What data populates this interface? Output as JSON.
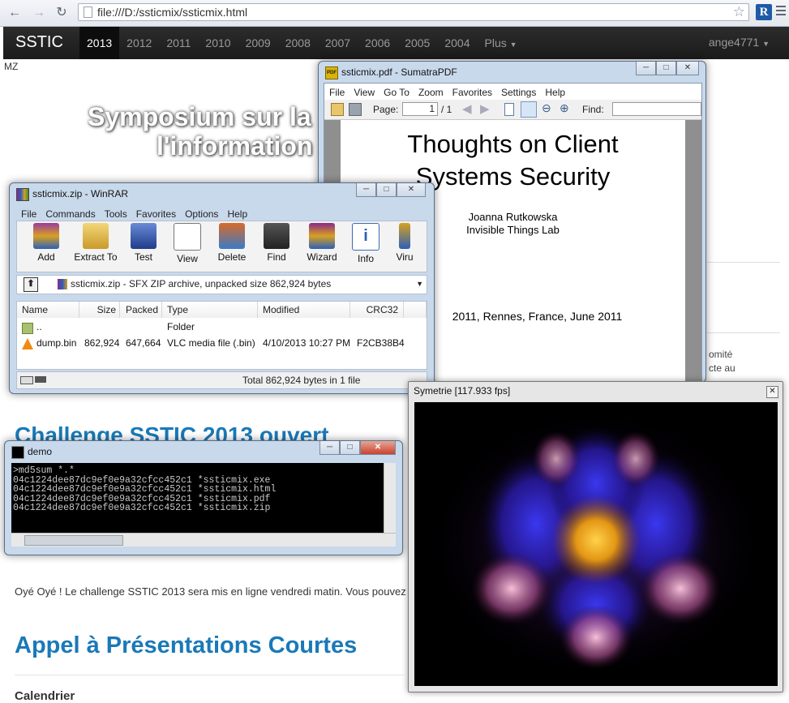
{
  "browser": {
    "url": "file:///D:/ssticmix/ssticmix.html",
    "back_icon": "arrow-left-icon",
    "forward_icon": "arrow-right-icon",
    "reload_icon": "reload-icon",
    "ext_label": "R"
  },
  "site": {
    "brand": "SSTIC",
    "years": [
      "2013",
      "2012",
      "2011",
      "2010",
      "2009",
      "2008",
      "2007",
      "2006",
      "2005",
      "2004"
    ],
    "more": "Plus",
    "user": "ange4771",
    "mz": "MZ",
    "title_l1": "Symposium sur la",
    "title_l2": "l'information",
    "challenge_heading": "Challenge SSTIC 2013 ouvert",
    "challenge_paragraph": "Oyé Oyé ! Le challenge SSTIC 2013 sera mis en ligne vendredi matin. Vous pouvez",
    "appel_heading": "Appel à Présentations Courtes",
    "calendrier": "Calendrier",
    "side_text_1": "omité",
    "side_text_2": "cte au"
  },
  "sumatra": {
    "title": "ssticmix.pdf - SumatraPDF",
    "menu": [
      "File",
      "View",
      "Go To",
      "Zoom",
      "Favorites",
      "Settings",
      "Help"
    ],
    "page_label": "Page:",
    "page_value": "1",
    "page_total": "/ 1",
    "find_label": "Find:",
    "pdf_title_l1": "Thoughts on Client",
    "pdf_title_l2": "Systems Security",
    "pdf_author": "Joanna Rutkowska",
    "pdf_affil": "Invisible Things Lab",
    "pdf_event": "2011, Rennes, France, June 2011"
  },
  "winrar": {
    "title": "ssticmix.zip - WinRAR",
    "menu": [
      "File",
      "Commands",
      "Tools",
      "Favorites",
      "Options",
      "Help"
    ],
    "tools": [
      "Add",
      "Extract To",
      "Test",
      "View",
      "Delete",
      "Find",
      "Wizard",
      "Info",
      "Viru"
    ],
    "path": "ssticmix.zip - SFX ZIP archive, unpacked size 862,924 bytes",
    "columns": [
      "Name",
      "Size",
      "Packed",
      "Type",
      "Modified",
      "CRC32"
    ],
    "rows": [
      {
        "name": "..",
        "size": "",
        "packed": "",
        "type": "Folder",
        "modified": "",
        "crc": ""
      },
      {
        "name": "dump.bin",
        "size": "862,924",
        "packed": "647,664",
        "type": "VLC media file (.bin)",
        "modified": "4/10/2013 10:27 PM",
        "crc": "F2CB38B4"
      }
    ],
    "status": "Total 862,924 bytes in 1 file"
  },
  "demo": {
    "title": "demo",
    "lines": [
      ">md5sum *.*",
      "04c1224dee87dc9ef0e9a32cfcc452c1 *ssticmix.exe",
      "04c1224dee87dc9ef0e9a32cfcc452c1 *ssticmix.html",
      "04c1224dee87dc9ef0e9a32cfcc452c1 *ssticmix.pdf",
      "04c1224dee87dc9ef0e9a32cfcc452c1 *ssticmix.zip"
    ]
  },
  "symetrie": {
    "title": "Symetrie [117.933 fps]"
  }
}
